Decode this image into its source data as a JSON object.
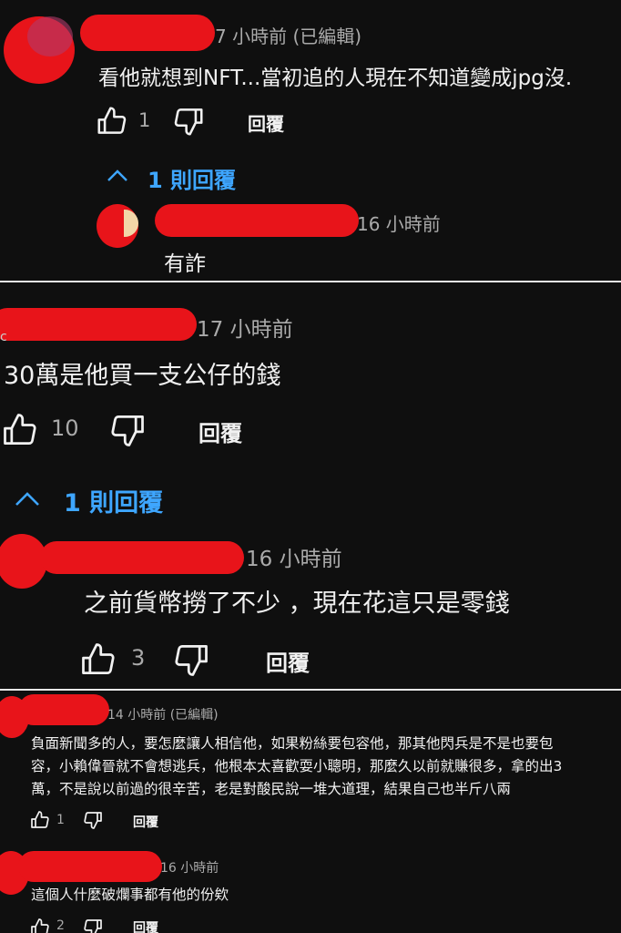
{
  "colors": {
    "background": "#0f0f0f",
    "text": "#f1f1f1",
    "meta": "#aaaaaa",
    "link": "#3ea6ff",
    "redaction": "#e8141a",
    "separator": "#e8e8e8"
  },
  "panel1": {
    "comment": {
      "time": "7 小時前 (已編輯)",
      "text": "看他就想到NFT...當初追的人現在不知道變成jpg沒.",
      "likes": "1",
      "reply_label": "回覆"
    },
    "replies_toggle": "1 則回覆",
    "reply": {
      "time": "16 小時前",
      "text": "有詐"
    }
  },
  "panel2": {
    "comment": {
      "time": "17 小時前",
      "text": "30萬是他買一支公仔的錢",
      "likes": "10",
      "reply_label": "回覆"
    },
    "replies_toggle": "1 則回覆",
    "reply": {
      "time": "16 小時前",
      "text": "之前貨幣撈了不少 ，現在花這只是零錢",
      "likes": "3",
      "reply_label": "回覆"
    }
  },
  "panel3": {
    "comment": {
      "time": "14 小時前 (已編輯)",
      "lines": [
        "負面新聞多的人，要怎麼讓人相信他，如果粉絲要包容他，那其他閃兵是不是也要包",
        "容，小賴偉晉就不會想逃兵，他根本太喜歡耍小聰明，那麼久以前就賺很多，拿的出3",
        "萬，不是說以前過的很辛苦，老是對酸民說一堆大道理，結果自己也半斤八兩"
      ],
      "likes": "1",
      "reply_label": "回覆"
    },
    "comment2": {
      "time": "16 小時前",
      "text": "這個人什麼破爛事都有他的份欸",
      "likes": "2",
      "reply_label": "回覆"
    }
  },
  "icons": {
    "like": "thumbs-up-icon",
    "dislike": "thumbs-down-icon",
    "collapse": "chevron-up-icon"
  }
}
